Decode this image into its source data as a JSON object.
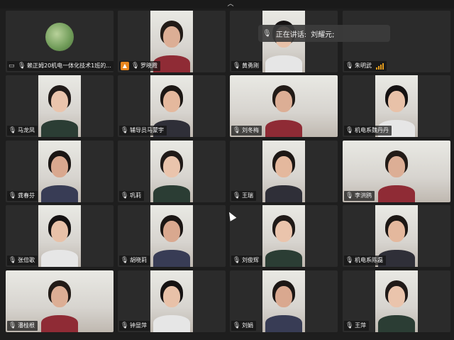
{
  "meeting": {
    "active_speaker_prefix": "正在讲话:",
    "active_speaker_name": "刘耀元;"
  },
  "participants": [
    {
      "name": "赖正姆20机电一体化技术1班的...",
      "type": "avatar",
      "icon": "screen-share-icon"
    },
    {
      "name": "罗晓霞",
      "type": "cam",
      "icon": "host-icon"
    },
    {
      "name": "黄勇刚",
      "type": "cam",
      "icon": "mic-icon"
    },
    {
      "name": "朱明武",
      "type": "off",
      "icon": "mic-icon",
      "signal": true
    },
    {
      "name": "马龙凤",
      "type": "cam",
      "icon": "mic-icon"
    },
    {
      "name": "辅导员马蒙宇",
      "type": "cam",
      "icon": "mic-icon"
    },
    {
      "name": "刘冬梅",
      "type": "wide",
      "icon": "mic-icon"
    },
    {
      "name": "机电系魏丹丹",
      "type": "cam",
      "icon": "mic-icon"
    },
    {
      "name": "龚春芬",
      "type": "cam",
      "icon": "mic-icon"
    },
    {
      "name": "巩莉",
      "type": "cam",
      "icon": "mic-icon"
    },
    {
      "name": "王瑞",
      "type": "cam",
      "icon": "mic-icon"
    },
    {
      "name": "李洪鸥",
      "type": "wide",
      "icon": "mic-icon"
    },
    {
      "name": "张倍歌",
      "type": "cam",
      "icon": "mic-icon"
    },
    {
      "name": "胡晓莉",
      "type": "cam",
      "icon": "mic-icon"
    },
    {
      "name": "刘俊辉",
      "type": "cam",
      "icon": "mic-icon"
    },
    {
      "name": "机电系陈磊",
      "type": "cam",
      "icon": "mic-icon"
    },
    {
      "name": "潘桂根",
      "type": "wide",
      "icon": "mic-icon"
    },
    {
      "name": "钟显萍",
      "type": "cam",
      "icon": "mic-icon"
    },
    {
      "name": "刘娟",
      "type": "cam",
      "icon": "mic-icon"
    },
    {
      "name": "王萍",
      "type": "cam",
      "icon": "mic-icon"
    }
  ]
}
